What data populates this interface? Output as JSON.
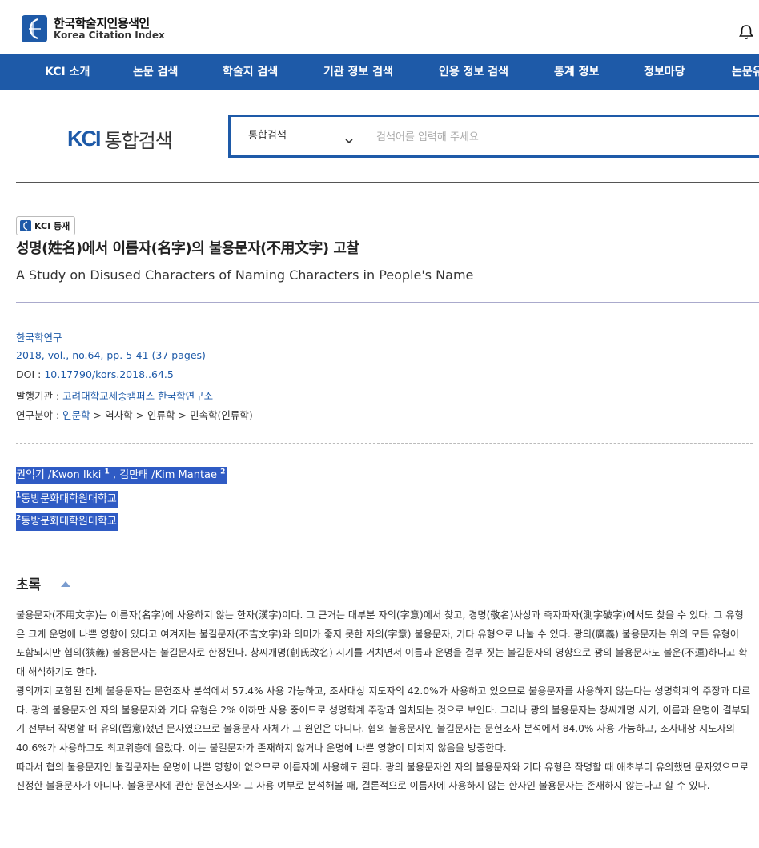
{
  "header": {
    "logo_ko": "한국학술지인용색인",
    "logo_en": "Korea Citation Index"
  },
  "nav": {
    "items": [
      "KCI 소개",
      "논문 검색",
      "학술지 검색",
      "기관 정보 검색",
      "인용 정보 검색",
      "통계 정보",
      "정보마당",
      "논문유"
    ]
  },
  "search": {
    "brand_kci": "KCI",
    "brand_text": "통합검색",
    "select_value": "통합검색",
    "placeholder": "검색어를 입력해 주세요"
  },
  "article": {
    "badge": "KCI 등재",
    "title_ko": "성명(姓名)에서 이름자(名字)의 불용문자(不用文字) 고찰",
    "title_en": "A Study on Disused Characters of Naming Characters in People's Name",
    "journal": "한국학연구",
    "issue": "2018, vol., no.64, pp. 5-41 (37 pages)",
    "doi_label": "DOI : ",
    "doi": "10.17790/kors.2018..64.5",
    "publisher_label": "발행기관 : ",
    "publisher": "고려대학교세종캠퍼스 한국학연구소",
    "field_label": "연구분야 : ",
    "field": [
      "인문학",
      "역사학",
      "인류학",
      "민속학(인류학)"
    ],
    "field_sep": " > ",
    "authors": [
      {
        "name": "권익기 /Kwon Ikki",
        "sup": "1"
      },
      {
        "name": "김만태 /Kim Mantae",
        "sup": "2"
      }
    ],
    "author_sep": " , ",
    "affiliations": [
      {
        "sup": "1",
        "name": "동방문화대학원대학교"
      },
      {
        "sup": "2",
        "name": "동방문화대학원대학교"
      }
    ]
  },
  "abstract": {
    "heading": "초록",
    "paragraphs": [
      "불용문자(不用文字)는 이름자(名字)에 사용하지 않는 한자(漢字)이다. 그 근거는 대부분 자의(字意)에서 찾고, 경명(敬名)사상과 측자파자(測字破字)에서도 찾을 수 있다. 그 유형은 크게 운명에 나쁜 영향이 있다고 여겨지는 불길문자(不吉文字)와 의미가 좋지 못한 자의(字意) 불용문자, 기타 유형으로 나눌 수 있다. 광의(廣義) 불용문자는 위의 모든 유형이 포함되지만 협의(狹義) 불용문자는 불길문자로 한정된다. 창씨개명(創氏改名) 시기를 거치면서 이름과 운명을 결부 짓는 불길문자의 영향으로 광의 불용문자도 불운(不運)하다고 확대 해석하기도 한다.",
      "광의까지 포함된 전체 불용문자는 문헌조사 분석에서 57.4% 사용 가능하고, 조사대상 지도자의 42.0%가 사용하고 있으므로 불용문자를 사용하지 않는다는 성명학계의 주장과 다르다. 광의 불용문자인 자의 불용문자와 기타 유형은 2% 이하만 사용 중이므로 성명학계 주장과 일치되는 것으로 보인다. 그러나 광의 불용문자는 창씨개명 시기, 이름과 운명이 결부되기 전부터 작명할 때 유의(留意)했던 문자였으므로 불용문자 자체가 그 원인은 아니다. 협의 불용문자인 불길문자는 문헌조사 분석에서 84.0% 사용 가능하고, 조사대상 지도자의 40.6%가 사용하고도 최고위층에 올랐다. 이는 불길문자가 존재하지 않거나 운명에 나쁜 영향이 미치지 않음을 방증한다.",
      "따라서 협의 불용문자인 불길문자는 운명에 나쁜 영향이 없으므로 이름자에 사용해도 된다. 광의 불용문자인 자의 불용문자와 기타 유형은 작명할 때 애초부터 유의했던 문자였으므로 진정한 불용문자가 아니다. 불용문자에 관한 문헌조사와 그 사용 여부로 분석해볼 때, 결론적으로 이름자에 사용하지 않는 한자인 불용문자는 존재하지 않는다고 할 수 있다."
    ]
  },
  "colors": {
    "brand_blue": "#1e5aa8",
    "link_blue": "#1e5aa8",
    "selection_blue": "#2f5bc4"
  },
  "icons": [
    "kci-logo-icon",
    "bell-icon",
    "chevron-down-icon",
    "kci-badge-icon",
    "collapse-triangle-icon"
  ]
}
